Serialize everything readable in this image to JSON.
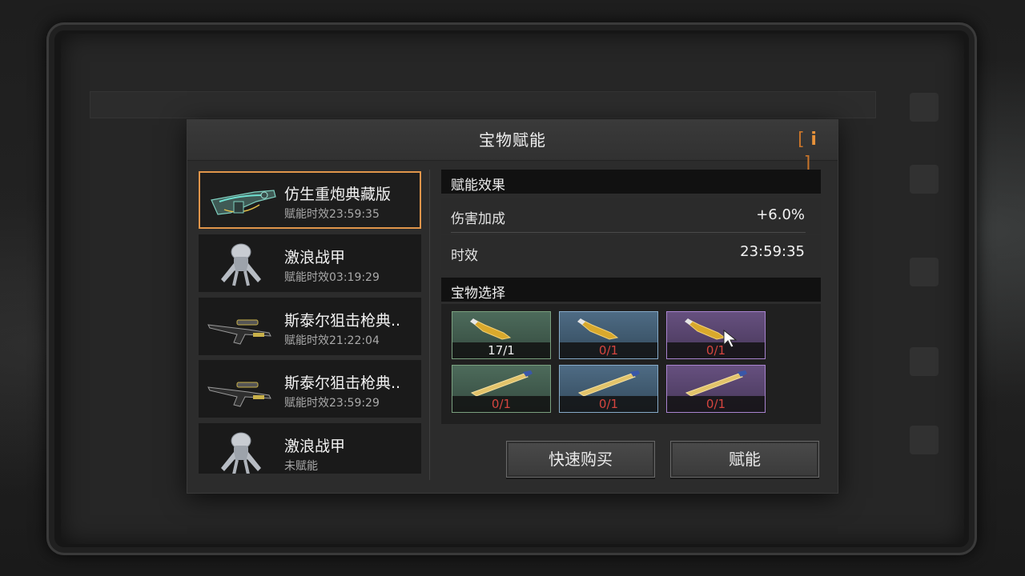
{
  "dialog": {
    "title": "宝物赋能",
    "info_icon": "info-icon"
  },
  "items": [
    {
      "name": "仿生重炮典藏版",
      "status": "赋能时效23:59:35",
      "icon": "heavy-cannon-icon",
      "selected": true
    },
    {
      "name": "激浪战甲",
      "status": "赋能时效03:19:29",
      "icon": "mech-armor-icon",
      "selected": false
    },
    {
      "name": "斯泰尔狙击枪典..",
      "status": "赋能时效21:22:04",
      "icon": "sniper-rifle-icon",
      "selected": false
    },
    {
      "name": "斯泰尔狙击枪典..",
      "status": "赋能时效23:59:29",
      "icon": "sniper-rifle-icon",
      "selected": false
    },
    {
      "name": "激浪战甲",
      "status": "未赋能",
      "icon": "mech-armor-icon",
      "selected": false
    }
  ],
  "effect": {
    "header": "赋能效果",
    "stats": [
      {
        "label": "伤害加成",
        "value": "+6.0%"
      },
      {
        "label": "时效",
        "value": "23:59:35"
      }
    ]
  },
  "treasure": {
    "header": "宝物选择",
    "slots": [
      {
        "rarity": "green",
        "icon": "potion-vial-icon",
        "count": "17/1",
        "available": true
      },
      {
        "rarity": "blue",
        "icon": "potion-vial-icon",
        "count": "0/1",
        "available": false
      },
      {
        "rarity": "purple",
        "icon": "potion-vial-icon",
        "count": "0/1",
        "available": false
      },
      {
        "rarity": "green",
        "icon": "syringe-icon",
        "count": "0/1",
        "available": false
      },
      {
        "rarity": "blue",
        "icon": "syringe-icon",
        "count": "0/1",
        "available": false
      },
      {
        "rarity": "purple",
        "icon": "syringe-icon",
        "count": "0/1",
        "available": false
      }
    ]
  },
  "buttons": {
    "quick_buy": "快速购买",
    "empower": "赋能"
  },
  "colors": {
    "accent_orange": "#e0954a",
    "count_red": "#d6453f",
    "rarity_green": "#7aa07f",
    "rarity_blue": "#86aac8",
    "rarity_purple": "#a883cf"
  }
}
